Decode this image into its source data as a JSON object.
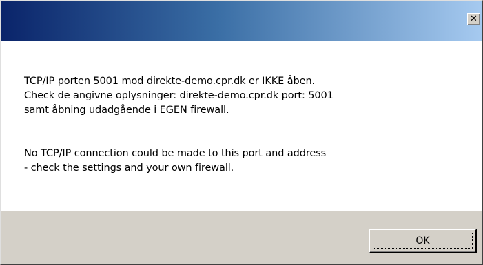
{
  "window": {
    "close_glyph": "✕"
  },
  "message": {
    "danish": "TCP/IP porten 5001 mod direkte-demo.cpr.dk er IKKE åben.\nCheck de angivne oplysninger: direkte-demo.cpr.dk port: 5001\nsamt åbning udadgående i EGEN firewall.",
    "english": "No TCP/IP connection could be made to this port and address\n- check the settings and your own firewall."
  },
  "buttons": {
    "ok_label": "OK"
  },
  "colors": {
    "titlebar_start": "#0a246a",
    "titlebar_end": "#a6caf0",
    "face": "#d4d0c8"
  }
}
